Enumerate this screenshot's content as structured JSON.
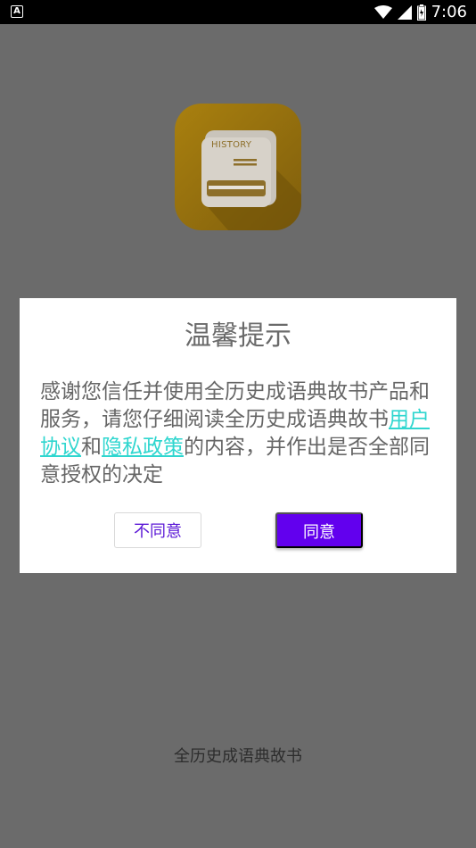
{
  "status_bar": {
    "notification_glyph": "A",
    "time": "7:06",
    "icons": [
      "wifi-icon",
      "signal-icon",
      "battery-icon"
    ]
  },
  "app": {
    "icon_text": "HISTORY",
    "name": "全历史成语典故书"
  },
  "dialog": {
    "title": "温馨提示",
    "body_pre": "感谢您信任并使用全历史成语典故书产品和服务，请您仔细阅读全历史成语典故书",
    "link_user_agreement": "用户协议",
    "body_mid": "和",
    "link_privacy_policy": "隐私政策",
    "body_post": "的内容，并作出是否全部同意授权的决定",
    "disagree_label": "不同意",
    "agree_label": "同意"
  },
  "colors": {
    "overlay": "#6b6b6b",
    "accent": "#6200ee",
    "link": "#2fd6cf",
    "icon_gold": "#a9800f"
  }
}
